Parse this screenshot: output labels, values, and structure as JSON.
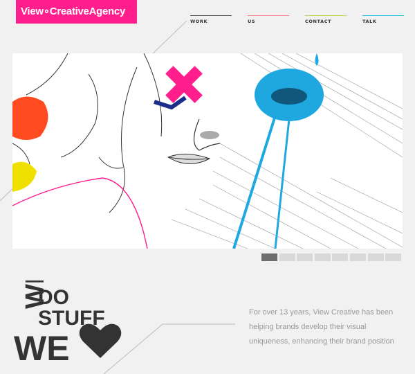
{
  "brand": {
    "logo_text": "View∘CreativeAgency",
    "accent": "#ff1e8c"
  },
  "nav": {
    "items": [
      {
        "label": "WORK",
        "color": "#555555"
      },
      {
        "label": "US",
        "color": "#f58a8a"
      },
      {
        "label": "CONTACT",
        "color": "#c5d44a"
      },
      {
        "label": "TALK",
        "color": "#2bc6d8"
      }
    ]
  },
  "hero": {
    "image": "illustrated faces artwork",
    "colors": [
      "#ff1e8c",
      "#1fa8e0",
      "#ff4b1f",
      "#f0e000"
    ]
  },
  "slider": {
    "slide_count": 8,
    "active_index": 0
  },
  "slogan": {
    "line1": "WE DO",
    "line2": "STUFF",
    "line3": "WE",
    "heart": "heart-icon"
  },
  "about": {
    "text": "For over 13 years, View Creative has been helping brands develop their visual uniqueness, enhancing their brand position"
  }
}
